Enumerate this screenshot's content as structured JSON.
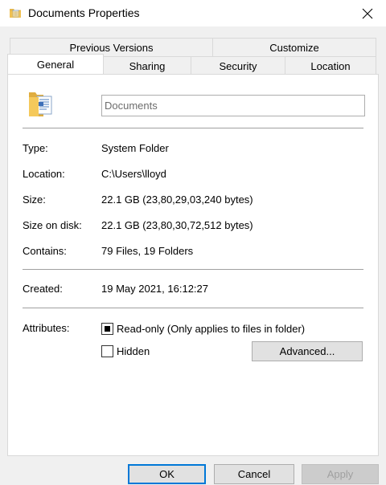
{
  "window": {
    "title": "Documents Properties"
  },
  "tabs": {
    "row_back": [
      "Previous Versions",
      "Customize"
    ],
    "row_front": [
      "General",
      "Sharing",
      "Security",
      "Location"
    ],
    "active": "General"
  },
  "general": {
    "name_value": "Documents",
    "type_label": "Type:",
    "type_value": "System Folder",
    "location_label": "Location:",
    "location_value": "C:\\Users\\lloyd",
    "size_label": "Size:",
    "size_value": "22.1 GB (23,80,29,03,240 bytes)",
    "size_on_disk_label": "Size on disk:",
    "size_on_disk_value": "22.1 GB (23,80,30,72,512 bytes)",
    "contains_label": "Contains:",
    "contains_value": "79 Files, 19 Folders",
    "created_label": "Created:",
    "created_value": "19 May 2021, 16:12:27",
    "attributes_label": "Attributes:",
    "readonly_label": "Read-only (Only applies to files in folder)",
    "readonly_state": "indeterminate",
    "hidden_label": "Hidden",
    "hidden_checked": false,
    "advanced_label": "Advanced..."
  },
  "footer": {
    "ok_label": "OK",
    "cancel_label": "Cancel",
    "apply_label": "Apply"
  },
  "icons": {
    "title": "folder-documents-icon",
    "close": "close-icon",
    "big": "folder-documents-icon"
  },
  "colors": {
    "accent": "#0078d7",
    "folder": "#f5c95b"
  }
}
